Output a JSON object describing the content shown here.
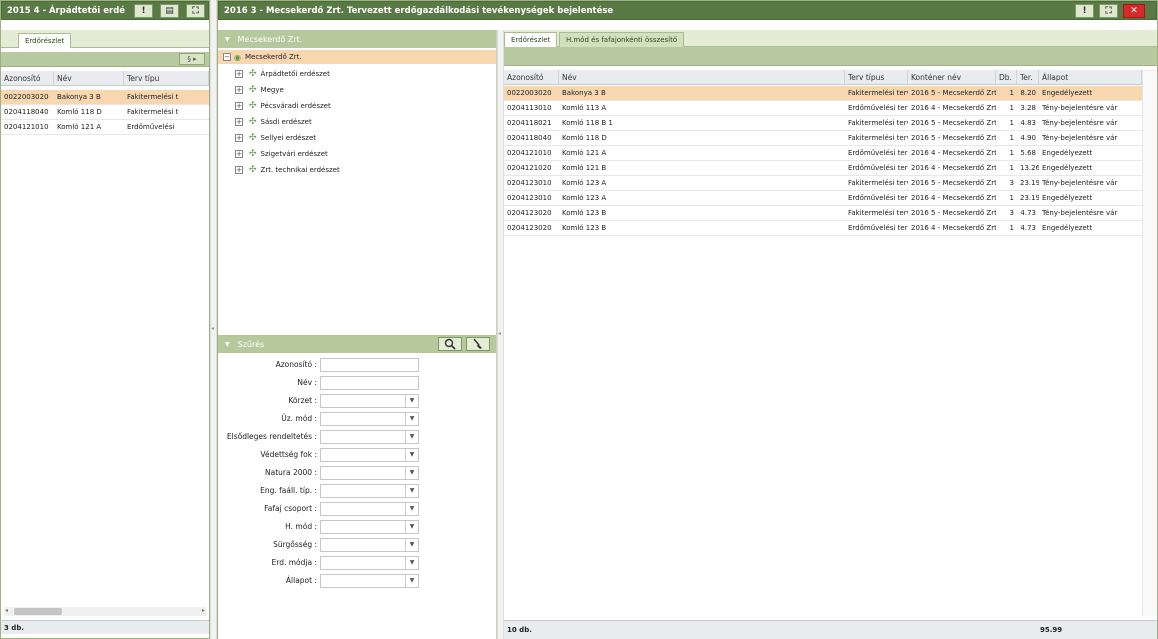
{
  "left_window": {
    "title": "2015 4 - Árpádtetői erdé",
    "btn_info": "!",
    "btn_print": "▤",
    "btn_max": "⛶",
    "tab": "Erdőrészlet",
    "toolbar_btn": "§ ▸",
    "columns": [
      "Azonosító",
      "Név",
      "Terv típu"
    ],
    "rows": [
      [
        "0022003020",
        "Bakonya 3 B",
        "Fakitermelési t"
      ],
      [
        "0204118040",
        "Komló 118 D",
        "Fakitermelési t"
      ],
      [
        "0204121010",
        "Komló 121 A",
        "Erdőművelési"
      ]
    ],
    "footer": "3 db."
  },
  "main_window": {
    "title": "2016 3 - Mecsekerdő Zrt. Tervezett erdőgazdálkodási tevékenységek bejelentése",
    "btn_info": "!",
    "btn_max": "⛶",
    "btn_close": "✕"
  },
  "tree_panel": {
    "header": "Mecsekerdő Zrt.",
    "root": "Mecsekerdő Zrt.",
    "items": [
      "Árpádtetői erdészet",
      "Megye",
      "Pécsváradi erdészet",
      "Sásdi erdészet",
      "Sellyei erdészet",
      "Szigetvári erdészet",
      "Zrt. technikai erdészet"
    ]
  },
  "filter_panel": {
    "header": "Szűrés",
    "fields": [
      {
        "label": "Azonosító :",
        "type": "input"
      },
      {
        "label": "Név :",
        "type": "input"
      },
      {
        "label": "Körzet :",
        "type": "select"
      },
      {
        "label": "Üz. mód :",
        "type": "select"
      },
      {
        "label": "Elsődleges rendeltetés :",
        "type": "select"
      },
      {
        "label": "Védettség fok :",
        "type": "select"
      },
      {
        "label": "Natura 2000 :",
        "type": "select"
      },
      {
        "label": "Eng. faáll. típ. :",
        "type": "select"
      },
      {
        "label": "Fafaj csoport :",
        "type": "select"
      },
      {
        "label": "H. mód :",
        "type": "select"
      },
      {
        "label": "Sürgősség :",
        "type": "select"
      },
      {
        "label": "Erd. módja :",
        "type": "select"
      },
      {
        "label": "Állapot :",
        "type": "select"
      }
    ]
  },
  "right_grid": {
    "tabs": [
      "Erdőrészlet",
      "H.mód és fafajonkénti összesítő"
    ],
    "columns": [
      "Azonosító",
      "Név",
      "Terv típus",
      "Konténer név",
      "Db.",
      "Ter.",
      "Állapot"
    ],
    "rows": [
      [
        "0022003020",
        "Bakonya 3 B",
        "Fakitermelési terv",
        "2016 5 - Mecsekerdő Zrt.",
        "1",
        "8.20",
        "Engedélyezett"
      ],
      [
        "0204113010",
        "Komló 113 A",
        "Erdőművelési terv",
        "2016 4 - Mecsekerdő Zrt.",
        "1",
        "3.28",
        "Tény-bejelentésre vár"
      ],
      [
        "0204118021",
        "Komló 118 B 1",
        "Fakitermelési terv",
        "2016 5 - Mecsekerdő Zrt.",
        "1",
        "4.83",
        "Tény-bejelentésre vár"
      ],
      [
        "0204118040",
        "Komló 118 D",
        "Fakitermelési terv",
        "2016 5 - Mecsekerdő Zrt.",
        "1",
        "4.90",
        "Tény-bejelentésre vár"
      ],
      [
        "0204121010",
        "Komló 121 A",
        "Erdőművelési terv",
        "2016 4 - Mecsekerdő Zrt.",
        "1",
        "5.68",
        "Engedélyezett"
      ],
      [
        "0204121020",
        "Komló 121 B",
        "Erdőművelési terv",
        "2016 4 - Mecsekerdő Zrt.",
        "1",
        "13.26",
        "Engedélyezett"
      ],
      [
        "0204123010",
        "Komló 123 A",
        "Fakitermelési terv",
        "2016 5 - Mecsekerdő Zrt.",
        "3",
        "23.19",
        "Tény-bejelentésre vár"
      ],
      [
        "0204123010",
        "Komló 123 A",
        "Erdőművelési terv",
        "2016 4 - Mecsekerdő Zrt.",
        "1",
        "23.19",
        "Engedélyezett"
      ],
      [
        "0204123020",
        "Komló 123 B",
        "Fakitermelési terv",
        "2016 5 - Mecsekerdő Zrt.",
        "3",
        "4.73",
        "Tény-bejelentésre vár"
      ],
      [
        "0204123020",
        "Komló 123 B",
        "Erdőművelési terv",
        "2016 4 - Mecsekerdő Zrt.",
        "1",
        "4.73",
        "Engedélyezett"
      ]
    ],
    "footer_count": "10 db.",
    "footer_total": "95.99"
  },
  "colors": {
    "title_bar": "#5a7a45",
    "selected_row": "#f7d6b0",
    "close_button": "#d42a2a"
  }
}
